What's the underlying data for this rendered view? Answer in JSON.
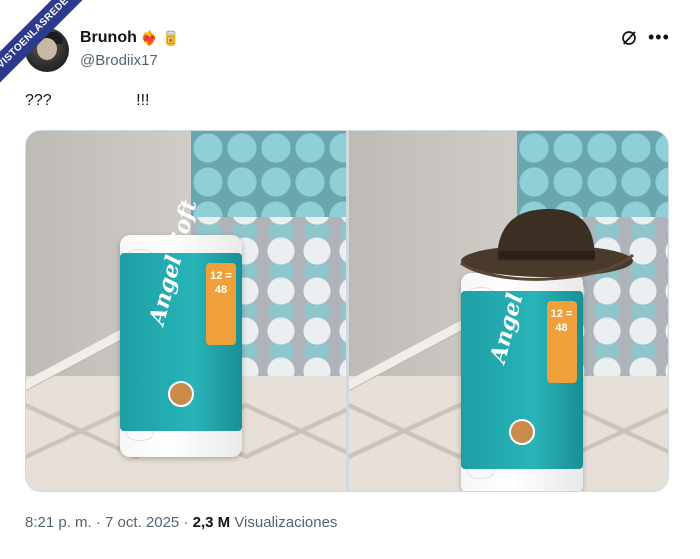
{
  "watermark": "VISTOENLASREDES",
  "user": {
    "display_name": "Brunoh",
    "emoji": "❤️‍🔥 🥫",
    "handle": "@Brodiix17"
  },
  "tweet": {
    "text": "???                   !!!"
  },
  "media": {
    "images": [
      {
        "pack_label_count": "12 = 48",
        "pack_brand": "Angel Soft"
      },
      {
        "pack_label_count": "12 = 48",
        "pack_brand": "Angel Soft"
      }
    ]
  },
  "footer": {
    "time": "8:21 p. m.",
    "separator": " · ",
    "date": "7 oct. 2025",
    "views_count": "2,3 M",
    "views_label": "Visualizaciones"
  },
  "icons": [
    "grok-icon",
    "more-icon"
  ],
  "colors": {
    "text": "#0f1419",
    "secondary": "#536471",
    "border": "#cfd9de"
  }
}
